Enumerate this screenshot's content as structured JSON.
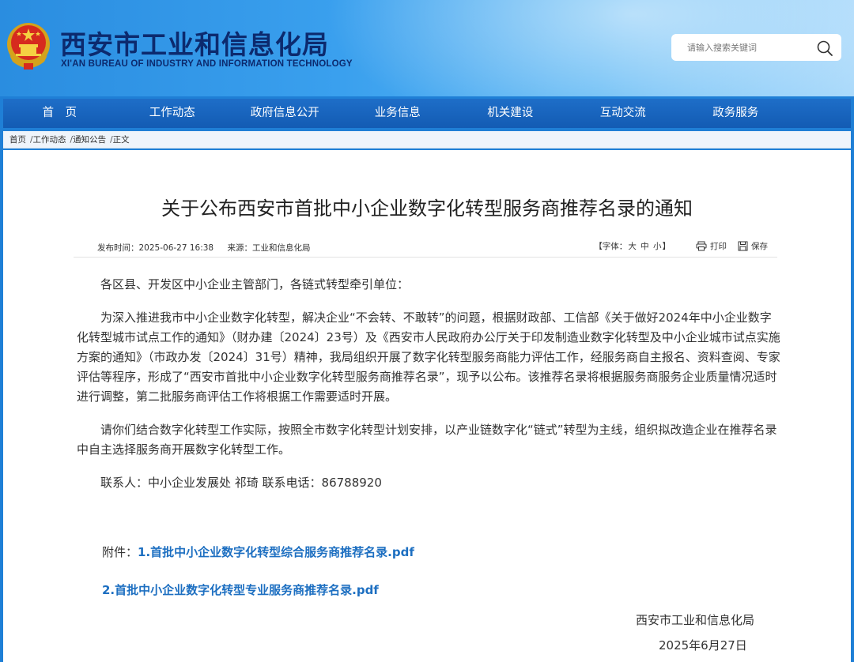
{
  "header": {
    "title": "西安市工业和信息化局",
    "subtitle": "XI'AN BUREAU OF INDUSTRY AND INFORMATION TECHNOLOGY",
    "search_placeholder": "请输入搜索关键词",
    "brand_color": "#0c2a6e"
  },
  "nav": {
    "items": [
      {
        "label": "首　页"
      },
      {
        "label": "工作动态"
      },
      {
        "label": "政府信息公开"
      },
      {
        "label": "业务信息"
      },
      {
        "label": "机关建设"
      },
      {
        "label": "互动交流"
      },
      {
        "label": "政务服务"
      }
    ],
    "bg_color": "#135bb3"
  },
  "breadcrumb": [
    "首页",
    "工作动态",
    "通知公告",
    "正文"
  ],
  "article": {
    "title": "关于公布西安市首批中小企业数字化转型服务商推荐名录的通知",
    "publish_time": "发布时间：2025-06-27 16:38",
    "source": "来源：工业和信息化局",
    "font_label_prefix": "【字体：",
    "font_large": "大",
    "font_medium": "中",
    "font_small": "小",
    "font_label_suffix": "】",
    "print_label": "打印",
    "save_label": "保存",
    "greeting": "各区县、开发区中小企业主管部门，各链式转型牵引单位：",
    "paragraph1": "为深入推进我市中小企业数字化转型，解决企业“不会转、不敢转”的问题，根据财政部、工信部《关于做好2024年中小企业数字化转型城市试点工作的通知》（财办建〔2024〕23号）及《西安市人民政府办公厅关于印发制造业数字化转型及中小企业城市试点实施方案的通知》（市政办发〔2024〕31号）精神，我局组织开展了数字化转型服务商能力评估工作，经服务商自主报名、资料查阅、专家评估等程序，形成了“西安市首批中小企业数字化转型服务商推荐名录”，现予以公布。该推荐名录将根据服务商服务企业质量情况适时进行调整，第二批服务商评估工作将根据工作需要适时开展。",
    "paragraph2": "请你们结合数字化转型工作实际，按照全市数字化转型计划安排，以产业链数字化“链式”转型为主线，组织拟改造企业在推荐名录中自主选择服务商开展数字化转型工作。",
    "contact": "联系人：中小企业发展处 祁琦 联系电话：86788920",
    "attachment_label": "附件：",
    "attachment1": "1.首批中小企业数字化转型综合服务商推荐名录.pdf",
    "attachment2": "2.首批中小企业数字化转型专业服务商推荐名录.pdf",
    "link_color": "#1d6fc1",
    "signature_org": "西安市工业和信息化局",
    "signature_date": "2025年6月27日"
  }
}
